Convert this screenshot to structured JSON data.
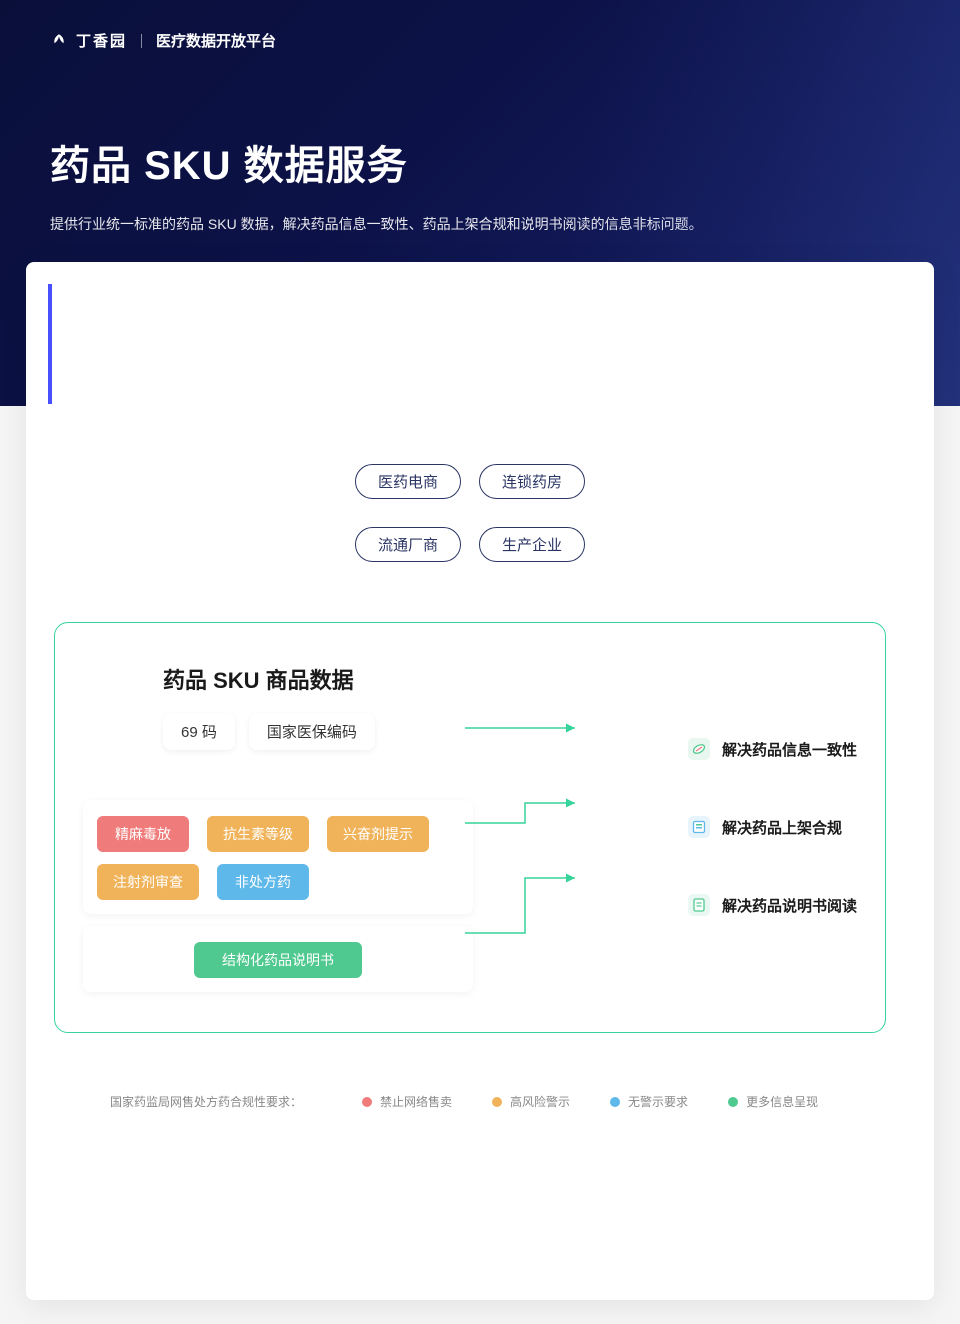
{
  "header": {
    "brand": "丁香园",
    "platform": "医疗数据开放平台"
  },
  "hero": {
    "title": "药品 SKU 数据服务",
    "subtitle": "提供行业统一标准的药品 SKU 数据，解决药品信息一致性、药品上架合规和说明书阅读的信息非标问题。"
  },
  "top_pills": {
    "row1": [
      "医药电商",
      "连锁药房"
    ],
    "row2": [
      "流通厂商",
      "生产企业"
    ]
  },
  "green_box": {
    "title": "药品 SKU 商品数据",
    "codes": [
      "69 码",
      "国家医保编码"
    ],
    "tags_row1": [
      {
        "label": "精麻毒放",
        "cls": "red"
      },
      {
        "label": "抗生素等级",
        "cls": "orange"
      },
      {
        "label": "兴奋剂提示",
        "cls": "orange"
      }
    ],
    "tags_row2": [
      {
        "label": "注射剂审查",
        "cls": "orange"
      },
      {
        "label": "非处方药",
        "cls": "blue"
      }
    ],
    "tag_single": {
      "label": "结构化药品说明书",
      "cls": "green"
    },
    "outputs": [
      "解决药品信息一致性",
      "解决药品上架合规",
      "解决药品说明书阅读"
    ]
  },
  "legend": {
    "label": "国家药监局网售处方药合规性要求：",
    "items": [
      {
        "label": "禁止网络售卖",
        "cls": "red"
      },
      {
        "label": "高风险警示",
        "cls": "orange"
      },
      {
        "label": "无警示要求",
        "cls": "blue"
      },
      {
        "label": "更多信息呈现",
        "cls": "green"
      }
    ]
  }
}
